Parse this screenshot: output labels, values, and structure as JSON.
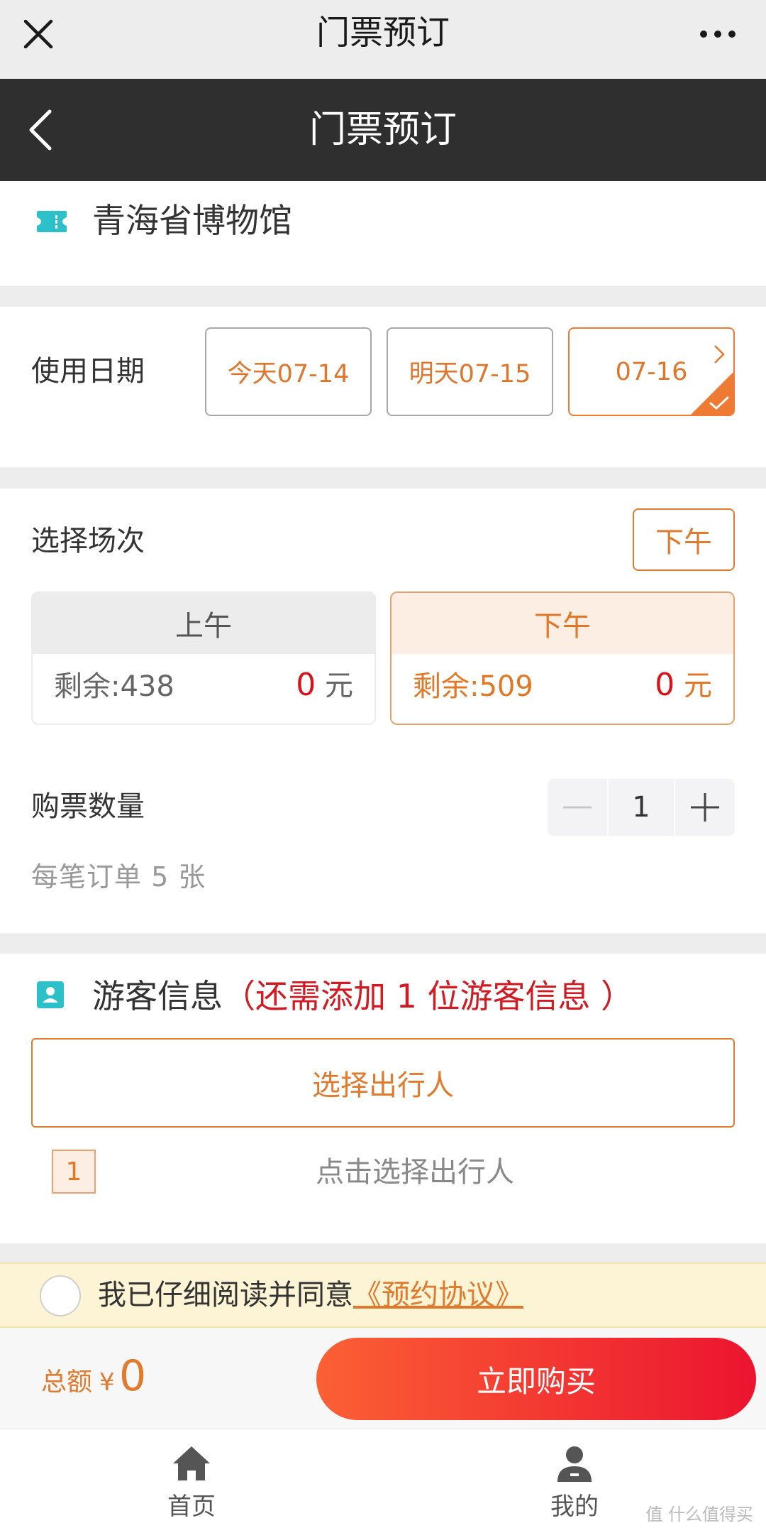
{
  "wechat_bar": {
    "title": "门票预订"
  },
  "header": {
    "title": "门票预订"
  },
  "museum": {
    "name": "青海省博物馆"
  },
  "date_section": {
    "label": "使用日期",
    "options": [
      {
        "label": "今天07-14"
      },
      {
        "label": "明天07-15"
      },
      {
        "label": "07-16",
        "selected": true
      }
    ]
  },
  "session_section": {
    "label": "选择场次",
    "selected_tag": "下午",
    "sessions": [
      {
        "name": "上午",
        "remaining": "剩余:438",
        "price": "0",
        "unit": "元"
      },
      {
        "name": "下午",
        "remaining": "剩余:509",
        "price": "0",
        "unit": "元",
        "selected": true
      }
    ]
  },
  "quantity_section": {
    "label": "购票数量",
    "value": "1",
    "limit_note": "每笔订单 5 张"
  },
  "guest_section": {
    "title": "游客信息",
    "warning": "（还需添加 1 位游客信息 ）",
    "pick_button": "选择出行人",
    "index": "1",
    "hint": "点击选择出行人"
  },
  "agreement": {
    "text": "我已仔细阅读并同意",
    "link": "《预约协议》"
  },
  "footer": {
    "total_label": "总额",
    "currency": "¥",
    "total_value": "0",
    "buy_button": "立即购买"
  },
  "tabbar": {
    "items": [
      {
        "label": "首页",
        "icon": "home-icon"
      },
      {
        "label": "我的",
        "icon": "user-icon"
      }
    ]
  },
  "watermark": "值 什么值得买",
  "colors": {
    "accent": "#e07a2e",
    "price_red": "#d9131c",
    "header_bg": "#2f2f2f",
    "teal_icon": "#2cc0c9",
    "buy_gradient": [
      "#fb6034",
      "#ec1430"
    ]
  }
}
